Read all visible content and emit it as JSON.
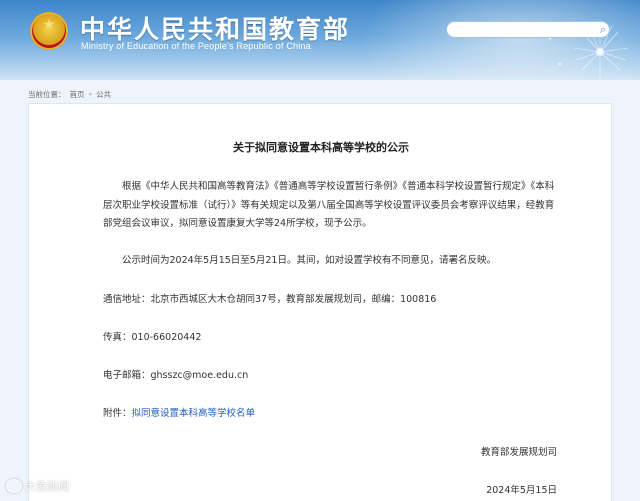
{
  "header": {
    "title": "中华人民共和国教育部",
    "subtitle": "Ministry of Education of the People's Republic of China",
    "search_placeholder": ""
  },
  "breadcrumb": {
    "label": "当前位置：",
    "home": "首页",
    "current": "公共"
  },
  "article": {
    "title": "关于拟同意设置本科高等学校的公示",
    "para1": "根据《中华人民共和国高等教育法》《普通高等学校设置暂行条例》《普通本科学校设置暂行规定》《本科层次职业学校设置标准（试行）》等有关规定以及第八届全国高等学校设置评议委员会考察评议结果，经教育部党组会议审议，拟同意设置康复大学等24所学校，现予公示。",
    "para2": "公示时间为2024年5月15日至5月21日。其间，如对设置学校有不同意见，请署名反映。",
    "address": "通信地址：北京市西城区大木仓胡同37号，教育部发展规划司，邮编：100816",
    "fax": "传真：010-66020442",
    "email": "电子邮箱：ghsszc@moe.edu.cn",
    "attachment_label": "附件：",
    "attachment_link": "拟同意设置本科高等学校名单",
    "signature": "教育部发展规划司",
    "date": "2024年5月15日"
  },
  "watermark": "大象新闻",
  "colors": {
    "header_blue": "#3e86c9",
    "link_blue": "#1f5fbf",
    "emblem_red": "#b8161c",
    "emblem_gold": "#d9a21c"
  }
}
